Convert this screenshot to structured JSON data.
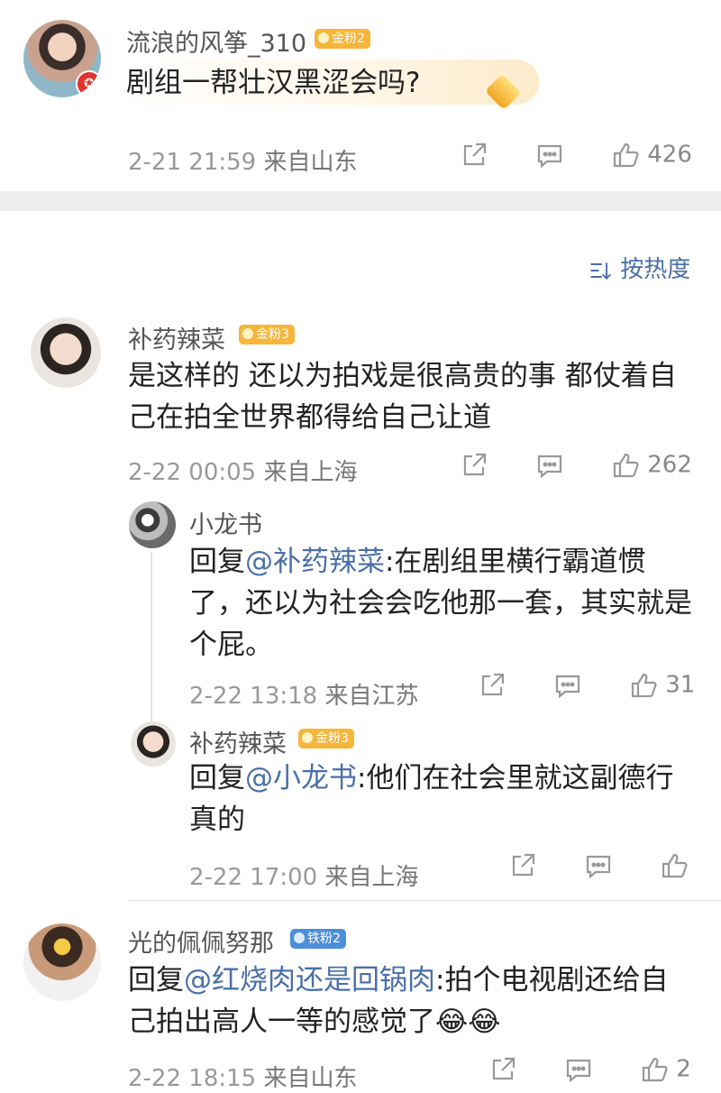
{
  "top_post": {
    "username": "流浪的风筝_310",
    "badge": "金粉2",
    "text": "剧组一帮壮汉黑涩会吗?",
    "time": "2-21 21:59",
    "location": "来自山东",
    "likes": "426"
  },
  "sort": {
    "label": "按热度",
    "icon": "sort-icon"
  },
  "comments": [
    {
      "username": "补药辣菜",
      "badge": "金粉3",
      "text": "是这样的 还以为拍戏是很高贵的事 都仗着自己在拍全世界都得给自己让道",
      "time": "2-22 00:05",
      "location": "来自上海",
      "likes": "262",
      "replies": [
        {
          "username": "小龙书",
          "reply_prefix": "回复",
          "mention": "@补药辣菜",
          "text": ":在剧组里横行霸道惯了，还以为社会会吃他那一套，其实就是个屁。",
          "time": "2-22 13:18",
          "location": "来自江苏",
          "likes": "31"
        },
        {
          "username": "补药辣菜",
          "badge": "金粉3",
          "reply_prefix": "回复",
          "mention": "@小龙书",
          "text": ":他们在社会里就这副德行 真的",
          "time": "2-22 17:00",
          "location": "来自上海",
          "likes": ""
        }
      ]
    },
    {
      "username": "光的佩佩努那",
      "badge": "铁粉2",
      "reply_prefix": "回复",
      "mention": "@红烧肉还是回锅肉",
      "text": ":拍个电视剧还给自己拍出高人一等的感觉了",
      "emoji": "😂😂",
      "time": "2-22 18:15",
      "location": "来自山东",
      "likes": "2"
    }
  ],
  "colors": {
    "mention": "#4a6fa8",
    "badge_gold": "#f5b63a",
    "badge_iron": "#4d8ed9",
    "divider": "#efefef"
  }
}
